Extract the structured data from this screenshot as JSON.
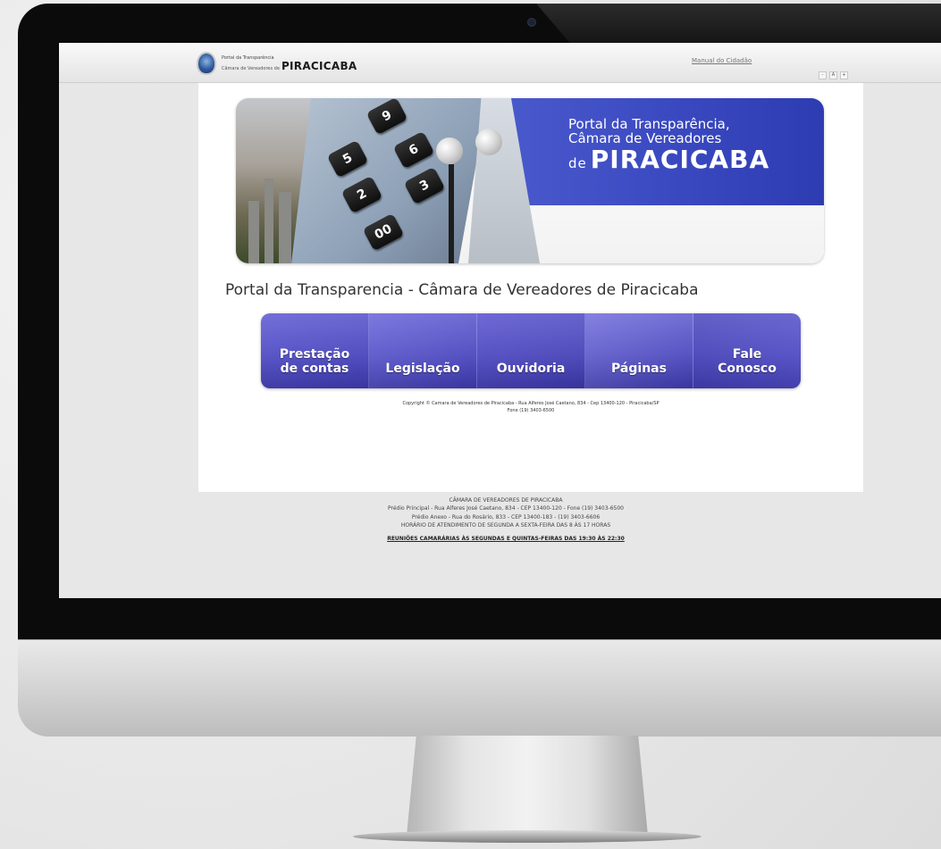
{
  "header": {
    "logo_small": "Portal da Transparência",
    "logo_camara": "Câmara de Vereadores de",
    "logo_city": "PIRACICABA",
    "manual_link": "Manual do Cidadão",
    "font_controls": [
      "-",
      "A",
      "+"
    ]
  },
  "banner": {
    "line1": "Portal da Transparência,",
    "line2": "Câmara de Vereadores",
    "de": "de",
    "city": "PIRACICABA",
    "keys": [
      "9",
      "6",
      "5",
      "3",
      "2",
      "00"
    ]
  },
  "main": {
    "title": "Portal da Transparencia - Câmara de Vereadores de Piracicaba"
  },
  "nav": {
    "items": [
      {
        "label": "Prestação\nde contas"
      },
      {
        "label": "Legislação"
      },
      {
        "label": "Ouvidoria"
      },
      {
        "label": "Páginas"
      },
      {
        "label": "Fale\nConosco"
      }
    ]
  },
  "copyright": {
    "line1": "Copyright © Camara de Vereadores de Piracicaba - Rua Alferes José Caetano, 834 - Cep 13400-120 - Piracicaba/SP",
    "line2": "Fone (19) 3403-6500"
  },
  "footer": {
    "line1": "CÂMARA DE VEREADORES DE PIRACICABA",
    "line2": "Prédio Principal - Rua Alferes José Caetano, 834 - CEP 13400-120 - Fone (19) 3403-6500",
    "line3": "Prédio Anexo - Rua do Rosário, 833 - CEP 13400-183 - (19) 3403-6606",
    "line4": "HORÁRIO DE ATENDIMENTO DE SEGUNDA A SEXTA-FEIRA DAS 8 ÀS 17 HORAS",
    "meetings": "REUNIÕES CAMARÁRIAS ÀS SEGUNDAS E QUINTAS-FEIRAS DAS 19:30 ÀS 22:30"
  },
  "colors": {
    "nav_blue": "#5551c8",
    "banner_blue": "#3a49c0"
  }
}
